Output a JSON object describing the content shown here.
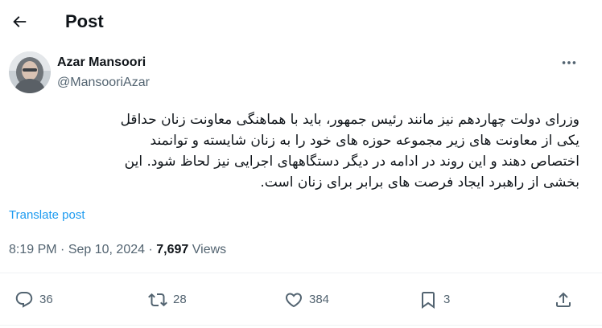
{
  "header": {
    "title": "Post",
    "back_icon": "arrow-left-icon"
  },
  "author": {
    "name": "Azar Mansoori",
    "handle": "@MansooriAzar",
    "avatar_icon": "avatar-photo"
  },
  "post": {
    "text": "وزرای دولت چهاردهم نیز مانند رئیس جمهور، باید با هماهنگی معاونت زنان حداقل\nیکی از معاونت های زیر مجموعه حوزه های خود را به زنان شایسته و توانمند\nاختصاص دهند و این روند در ادامه در دیگر دستگاههای اجرایی نیز لحاظ شود. این\nبخشی از راهبرد ایجاد فرصت های برابر برای زنان است.",
    "translate_label": "Translate post"
  },
  "meta": {
    "time": "8:19 PM",
    "separator": "·",
    "date": "Sep 10, 2024",
    "views_count": "7,697",
    "views_label": "Views"
  },
  "actions": {
    "replies": "36",
    "reposts": "28",
    "likes": "384",
    "bookmarks": "3"
  },
  "colors": {
    "text": "#0f1419",
    "secondary": "#536471",
    "link": "#1d9bf0",
    "divider": "#eff3f4"
  }
}
